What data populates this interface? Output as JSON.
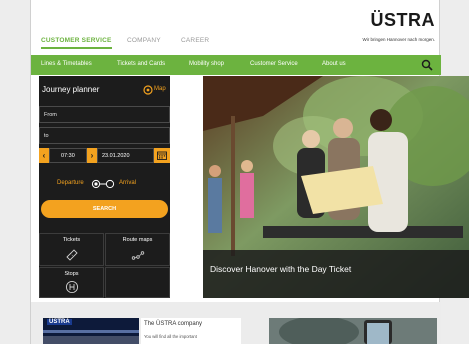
{
  "header": {
    "tabs": [
      {
        "label": "CUSTOMER SERVICE",
        "active": true
      },
      {
        "label": "COMPANY",
        "active": false
      },
      {
        "label": "CAREER",
        "active": false
      }
    ],
    "logo": "ÜSTRA",
    "tagline": "Wir bringen Hannover nach morgen."
  },
  "menu": {
    "items": [
      "Lines & Timetables",
      "Tickets and Cards",
      "Mobility shop",
      "Customer Service",
      "About us"
    ],
    "search_icon": "search-icon"
  },
  "journey_planner": {
    "title": "Journey planner",
    "map_label": "Map",
    "from_placeholder": "From",
    "to_placeholder": "to",
    "time_prev": "‹",
    "time": "07:30",
    "time_next": "›",
    "date": "23.01.2020",
    "departure_label": "Departure",
    "arrival_label": "Arrival",
    "search_label": "SEARCH"
  },
  "quick_links": [
    {
      "label": "Tickets",
      "icon": "ticket-icon"
    },
    {
      "label": "Route maps",
      "icon": "route-icon"
    },
    {
      "label": "Stops",
      "icon": "stop-h-icon"
    },
    {
      "label": "",
      "icon": ""
    }
  ],
  "hero": {
    "caption": "Discover Hanover with the Day Ticket"
  },
  "lower": {
    "card1_brand": "ÜSTRA",
    "card1_title": "The ÜSTRA company",
    "card1_text": "You will find all the important"
  },
  "colors": {
    "accent_green": "#6cb33f",
    "accent_orange": "#f3a21f",
    "panel_dark": "#1c1c1c"
  }
}
